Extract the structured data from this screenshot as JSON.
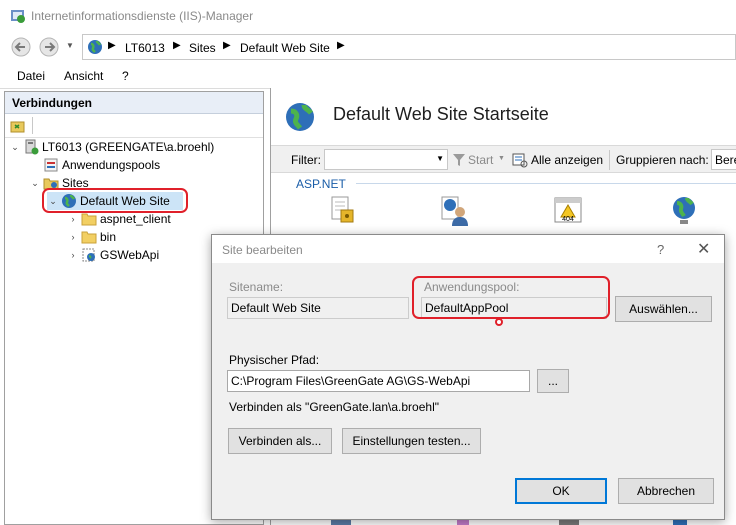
{
  "window": {
    "title": "Internetinformationsdienste (IIS)-Manager"
  },
  "address": {
    "crumbs": [
      "LT6013",
      "Sites",
      "Default Web Site"
    ]
  },
  "menu": {
    "items": [
      "Datei",
      "Ansicht",
      "?"
    ]
  },
  "connections": {
    "header": "Verbindungen",
    "tree": [
      {
        "label": "LT6013 (GREENGATE\\a.broehl)"
      },
      {
        "label": "Anwendungspools"
      },
      {
        "label": "Sites"
      },
      {
        "label": "Default Web Site"
      },
      {
        "label": "aspnet_client"
      },
      {
        "label": "bin"
      },
      {
        "label": "GSWebApi"
      }
    ]
  },
  "main": {
    "title": "Default Web Site Startseite",
    "filter_label": "Filter:",
    "start_label": "Start",
    "show_all_label": "Alle anzeigen",
    "group_label": "Gruppieren nach:",
    "group_value": "Bere",
    "section": "ASP.NET"
  },
  "dialog": {
    "title": "Site bearbeiten",
    "help": "?",
    "sitename_label": "Sitename:",
    "sitename_value": "Default Web Site",
    "apppool_label": "Anwendungspool:",
    "apppool_value": "DefaultAppPool",
    "select_button": "Auswählen...",
    "path_label": "Physischer Pfad:",
    "path_value": "C:\\Program Files\\GreenGate AG\\GS-WebApi",
    "browse_button": "...",
    "connect_as_text": "Verbinden als \"GreenGate.lan\\a.broehl\"",
    "connect_as_button": "Verbinden als...",
    "test_button": "Einstellungen testen...",
    "ok_button": "OK",
    "cancel_button": "Abbrechen"
  },
  "colors": {
    "highlight_red": "#e0202a",
    "default_button_border": "#0078d7",
    "section_blue": "#1a5da8"
  }
}
